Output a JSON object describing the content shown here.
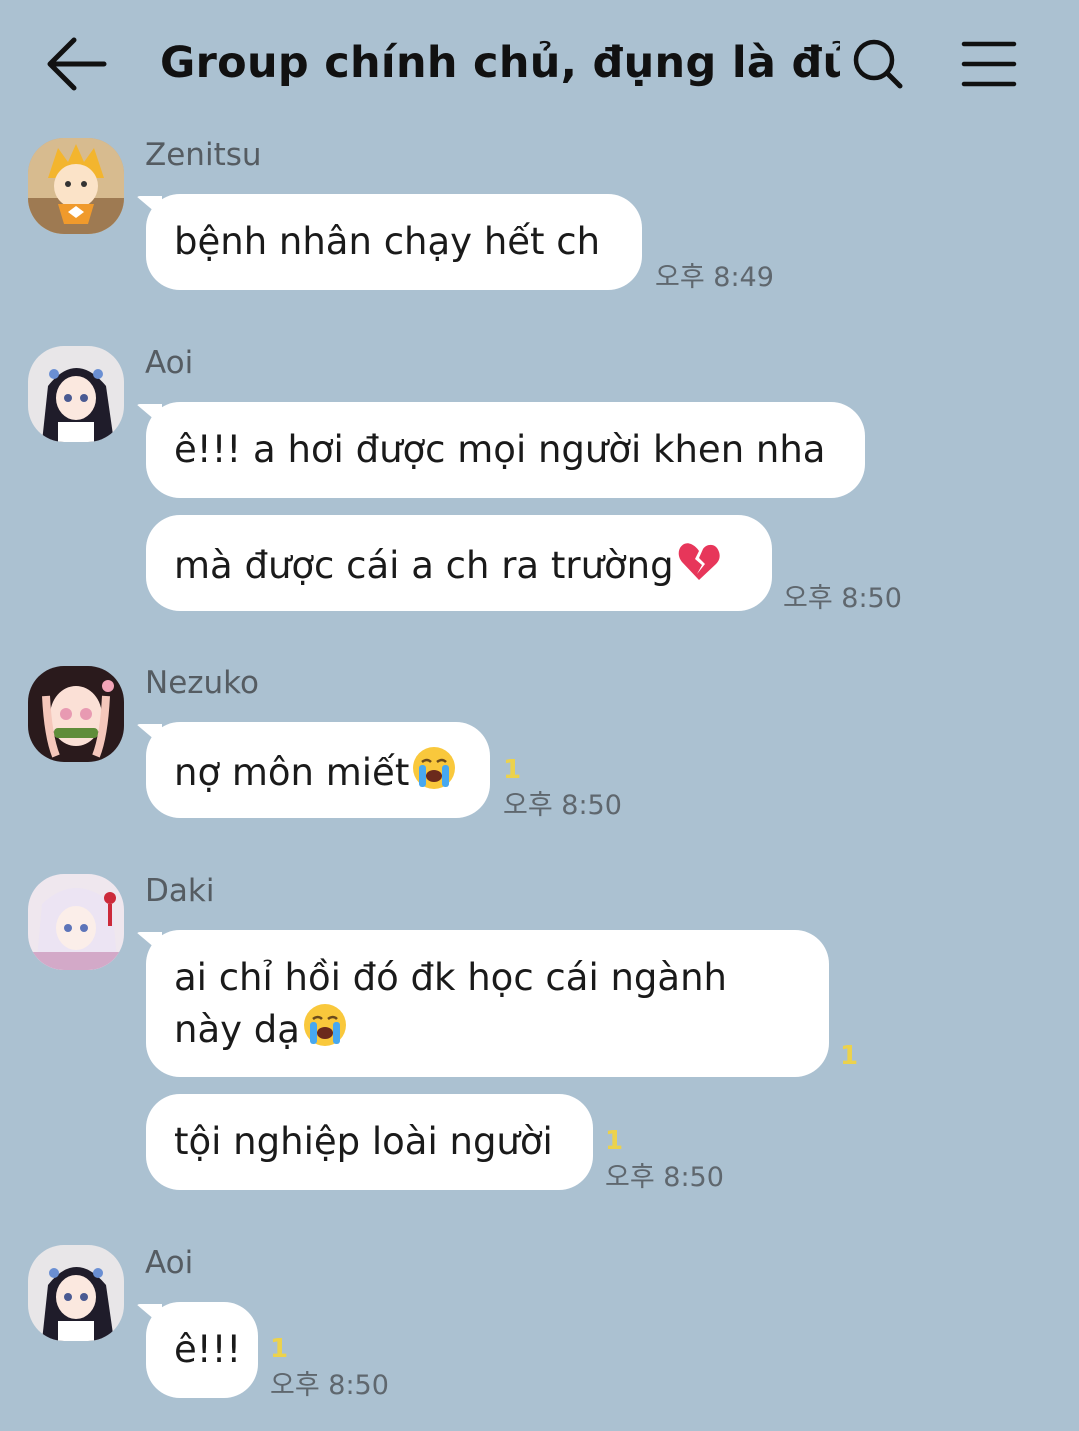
{
  "header": {
    "title": "Group chính chủ, đụng là đủ ...",
    "back_icon": "arrow-left-icon",
    "search_icon": "search-icon",
    "menu_icon": "hamburger-menu-icon"
  },
  "colors": {
    "background": "#abc1d1",
    "bubble": "#ffffff",
    "unread": "#ecd24c"
  },
  "messages": [
    {
      "sender": "Zenitsu",
      "bubbles": [
        {
          "text": "bệnh nhân chạy hết ch",
          "time": "오후 8:49"
        }
      ]
    },
    {
      "sender": "Aoi",
      "bubbles": [
        {
          "text": "ê!!! a hơi được mọi người khen nha"
        },
        {
          "text": "mà được cái a ch ra trường",
          "emoji": "broken-heart-icon",
          "time": "오후 8:50"
        }
      ]
    },
    {
      "sender": "Nezuko",
      "bubbles": [
        {
          "text": "nợ môn miết",
          "emoji": "crying-face-icon",
          "unread": "1",
          "time": "오후 8:50"
        }
      ]
    },
    {
      "sender": "Daki",
      "bubbles": [
        {
          "line1": "ai chỉ hồi đó đk học cái ngành",
          "line2": "này dạ",
          "emoji": "crying-face-icon",
          "unread": "1"
        },
        {
          "text": "tội nghiệp loài người",
          "unread": "1",
          "time": "오후 8:50"
        }
      ]
    },
    {
      "sender": "Aoi",
      "bubbles": [
        {
          "text": "ê!!!",
          "unread": "1",
          "time": "오후 8:50"
        }
      ]
    }
  ]
}
